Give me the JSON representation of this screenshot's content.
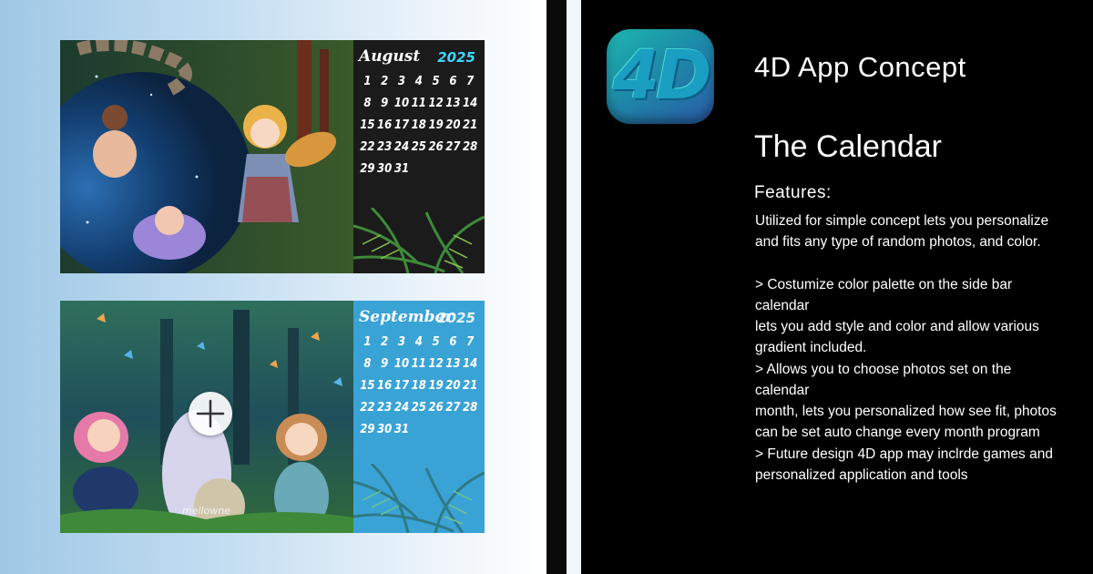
{
  "calendars": [
    {
      "month": "August",
      "year": "2025",
      "days": [
        "1",
        "2",
        "3",
        "4",
        "5",
        "6",
        "7",
        "8",
        "9",
        "10",
        "11",
        "12",
        "13",
        "14",
        "15",
        "16",
        "17",
        "18",
        "19",
        "20",
        "21",
        "22",
        "23",
        "24",
        "25",
        "26",
        "27",
        "28",
        "29",
        "30",
        "31"
      ],
      "theme": "#1b1b1b",
      "year_color": "#3fd6ff"
    },
    {
      "month": "September",
      "year": "2025",
      "days": [
        "1",
        "2",
        "3",
        "4",
        "5",
        "6",
        "7",
        "8",
        "9",
        "10",
        "11",
        "12",
        "13",
        "14",
        "15",
        "16",
        "17",
        "18",
        "19",
        "20",
        "21",
        "22",
        "23",
        "24",
        "25",
        "26",
        "27",
        "28",
        "29",
        "30",
        "31"
      ],
      "theme": "#3aa3d6",
      "year_color": "#e9f6ff",
      "add_photo_icon": "plus-icon",
      "artist_signature": "mellowne"
    }
  ],
  "app": {
    "icon_text": "4D",
    "title": "4D App Concept",
    "heading": "The Calendar",
    "features_label": "Features:",
    "paragraphs": {
      "intro": "Utilized for simple concept lets you personalize\nand fits any type of random photos, and color.",
      "palette": "> Costumize color palette on the side bar calendar\n   lets you add style and color and allow various\n   gradient included.",
      "photos": "> Allows you to choose photos set on the calendar\n   month, lets you personalized how see fit, photos\n   can be set auto change every month program",
      "future": "> Future design 4D app may inclrde games and\n   personalized application and tools"
    }
  },
  "colors": {
    "left_gradient_start": "#9fc8e6",
    "right_background": "#000000",
    "icon_teal": "#1fb7b0",
    "icon_blue": "#2a5aa6"
  }
}
